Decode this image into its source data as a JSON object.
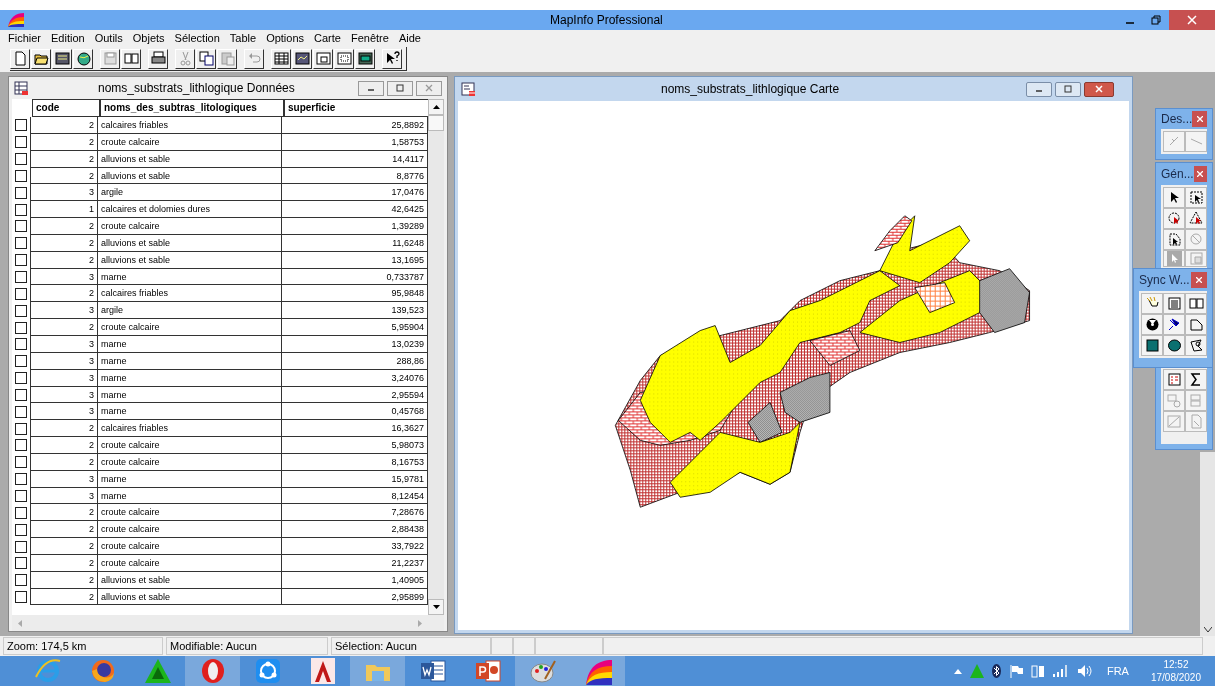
{
  "window": {
    "title": "MapInfo Professional"
  },
  "menu": [
    "Fichier",
    "Edition",
    "Outils",
    "Objets",
    "Sélection",
    "Table",
    "Options",
    "Carte",
    "Fenêtre",
    "Aide"
  ],
  "browser": {
    "title": "noms_substrats_lithlogique Données",
    "columns": [
      "code",
      "noms_des_subtras_litologiques",
      "superficie"
    ],
    "rows": [
      {
        "code": "2",
        "nom": "calcaires friables",
        "superficie": "25,8892",
        "selected": false
      },
      {
        "code": "2",
        "nom": "croute calcaire",
        "superficie": "1,58753",
        "selected": false
      },
      {
        "code": "2",
        "nom": "alluvions et sable",
        "superficie": "14,4117",
        "selected": false
      },
      {
        "code": "2",
        "nom": "alluvions et sable",
        "superficie": "8,8776",
        "selected": false
      },
      {
        "code": "3",
        "nom": "argile",
        "superficie": "17,0476",
        "selected": false
      },
      {
        "code": "1",
        "nom": "calcaires et dolomies dures",
        "superficie": "42,6425",
        "selected": false
      },
      {
        "code": "2",
        "nom": "croute calcaire",
        "superficie": "1,39289",
        "selected": false
      },
      {
        "code": "2",
        "nom": "alluvions et sable",
        "superficie": "11,6248",
        "selected": false
      },
      {
        "code": "2",
        "nom": "alluvions et sable",
        "superficie": "13,1695",
        "selected": false
      },
      {
        "code": "3",
        "nom": "marne",
        "superficie": "0,733787",
        "selected": false
      },
      {
        "code": "2",
        "nom": "calcaires friables",
        "superficie": "95,9848",
        "selected": false
      },
      {
        "code": "3",
        "nom": "argile",
        "superficie": "139,523",
        "selected": false
      },
      {
        "code": "2",
        "nom": "croute calcaire",
        "superficie": "5,95904",
        "selected": false
      },
      {
        "code": "3",
        "nom": "marne",
        "superficie": "13,0239",
        "selected": false
      },
      {
        "code": "3",
        "nom": "marne",
        "superficie": "288,86",
        "selected": false
      },
      {
        "code": "3",
        "nom": "marne",
        "superficie": "3,24076",
        "selected": false
      },
      {
        "code": "3",
        "nom": "marne",
        "superficie": "2,95594",
        "selected": false
      },
      {
        "code": "3",
        "nom": "marne",
        "superficie": "0,45768",
        "selected": false
      },
      {
        "code": "2",
        "nom": "calcaires friables",
        "superficie": "16,3627",
        "selected": false
      },
      {
        "code": "2",
        "nom": "croute calcaire",
        "superficie": "5,98073",
        "selected": false
      },
      {
        "code": "2",
        "nom": "croute calcaire",
        "superficie": "8,16753",
        "selected": false
      },
      {
        "code": "3",
        "nom": "marne",
        "superficie": "15,9781",
        "selected": false
      },
      {
        "code": "3",
        "nom": "marne",
        "superficie": "8,12454",
        "selected": false
      },
      {
        "code": "2",
        "nom": "croute calcaire",
        "superficie": "7,28676",
        "selected": false
      },
      {
        "code": "2",
        "nom": "croute calcaire",
        "superficie": "2,88438",
        "selected": false
      },
      {
        "code": "2",
        "nom": "croute calcaire",
        "superficie": "33,7922",
        "selected": false
      },
      {
        "code": "2",
        "nom": "croute calcaire",
        "superficie": "21,2237",
        "selected": false
      },
      {
        "code": "2",
        "nom": "alluvions et sable",
        "superficie": "1,40905",
        "selected": false
      },
      {
        "code": "2",
        "nom": "alluvions et sable",
        "superficie": "2,95899",
        "selected": false
      }
    ]
  },
  "map_window": {
    "title": "noms_substrats_lithlogique Carte"
  },
  "palettes": [
    {
      "title": "Des..."
    },
    {
      "title": "Gén..."
    },
    {
      "title": "Sync W..."
    }
  ],
  "status_bar": [
    "Zoom: 174,5 km",
    "Modifiable: Aucun",
    "Sélection: Aucun"
  ],
  "taskbar": {
    "apps": [
      {
        "kind": "ie",
        "running": false
      },
      {
        "kind": "firefox",
        "running": false
      },
      {
        "kind": "triangle",
        "running": false
      },
      {
        "kind": "opera",
        "running": true
      },
      {
        "kind": "share",
        "running": false
      },
      {
        "kind": "autocad",
        "running": false
      },
      {
        "kind": "explorer",
        "running": true
      },
      {
        "kind": "word",
        "running": false
      },
      {
        "kind": "powerpoint",
        "running": false
      },
      {
        "kind": "paint",
        "running": true
      },
      {
        "kind": "mapinfo",
        "running": true
      }
    ],
    "language": "FRA",
    "time": "12:52",
    "date": "17/08/2020"
  }
}
